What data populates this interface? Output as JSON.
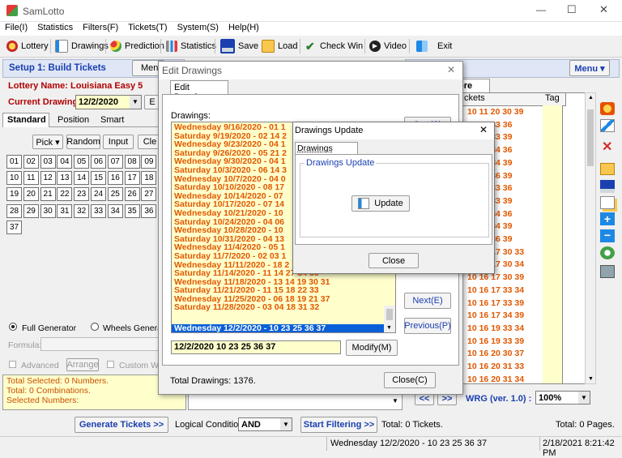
{
  "app": {
    "title": "SamLotto",
    "minimize": "—",
    "maximize": "☐",
    "close": "✕"
  },
  "menu": [
    "File(I)",
    "Statistics",
    "Filters(F)",
    "Tickets(T)",
    "System(S)",
    "Help(H)"
  ],
  "toolbar": {
    "lottery": "Lottery",
    "drawings": "Drawings",
    "prediction": "Prediction",
    "statistics": "Statistics",
    "save": "Save",
    "load": "Load",
    "check_win": "Check Win",
    "video": "Video",
    "exit": "Exit"
  },
  "left": {
    "setup": "Setup 1: Build  Tickets",
    "menu_btn": "Menu",
    "lottery_name": "Lottery  Name: Louisiana Easy 5",
    "current_drawing_label": "Current Drawing:",
    "current_drawing_value": "12/2/2020",
    "b_btn": "E",
    "tabs": [
      "Standard",
      "Position",
      "Smart"
    ],
    "pick": "Pick ▾",
    "random": "Random",
    "input": "Input",
    "clear": "Cle",
    "numbers": [
      "01",
      "02",
      "03",
      "04",
      "05",
      "06",
      "07",
      "08",
      "09",
      "10",
      "11",
      "12",
      "13",
      "14",
      "15",
      "16",
      "17",
      "18",
      "19",
      "20",
      "21",
      "22",
      "23",
      "24",
      "25",
      "26",
      "27",
      "28",
      "29",
      "30",
      "31",
      "32",
      "33",
      "34",
      "35",
      "36",
      "37"
    ],
    "full_generator": "Full Generator",
    "wheels_generator": "Wheels Generat",
    "formula": "Formula:",
    "advanced": "Advanced",
    "arrange": "Arrange",
    "custom": "Custom Wh",
    "status": [
      "Total Selected: 0 Numbers.",
      "Total: 0 Combinations.",
      "Selected Numbers:"
    ]
  },
  "right": {
    "menu_btn": "Menu ▾",
    "tab_fragment": "ore",
    "col_tickets": "ckets",
    "col_tag": "Tag",
    "tickets": [
      "10 11 20 30 39",
      "10 20 33 36",
      "10 20 33 39",
      "10 20 34 36",
      "10 20 34 39",
      "10 20 36 39",
      "10 30 33 36",
      "10 30 33 39",
      "10 30 34 36",
      "10 30 34 39",
      "10 30 36 39",
      "10 16 17 30 33",
      "10 16 17 30 34",
      "10 16 17 30 39",
      "10 16 17 33 34",
      "10 16 17 33 39",
      "10 16 17 34 39",
      "10 16 19 33 34",
      "10 16 19 33 39",
      "10 16 20 30 37",
      "10 16 20 31 33",
      "10 16 20 31 34"
    ],
    "wrg": "WRG (ver. 1.0) :",
    "zoom": "100%"
  },
  "bottom": {
    "generate": "Generate Tickets >>",
    "logical": "Logical Condition:",
    "logical_value": "AND",
    "filtering": "Start Filtering >>",
    "total_tickets": "Total: 0 Tickets.",
    "total_pages": "Total: 0 Pages.",
    "status_drawing": "Wednesday 12/2/2020 - 10 23 25 36 37",
    "status_time": "2/18/2021 8:21:42 PM"
  },
  "edit_drawings": {
    "title": "Edit Drawings",
    "tab": "Edit Drawings",
    "label": "Drawings:",
    "items": [
      "Wednesday 9/16/2020 - 01 1",
      "Saturday 9/19/2020 - 02 14 2",
      "Wednesday 9/23/2020 - 04 1",
      "Saturday 9/26/2020 - 05 21 2",
      "Wednesday 9/30/2020 - 04 1",
      "Saturday 10/3/2020 - 06 14 3",
      "Wednesday 10/7/2020 - 04 0",
      "Saturday 10/10/2020 - 08 17",
      "Wednesday 10/14/2020 - 07",
      "Saturday 10/17/2020 - 07 14",
      "Wednesday 10/21/2020 - 10",
      "Saturday 10/24/2020 - 04 06",
      "Wednesday 10/28/2020 - 10",
      "Saturday 10/31/2020 - 04 13",
      "Wednesday 11/4/2020 - 05 1",
      "Saturday 11/7/2020 - 02 03 1",
      "Wednesday 11/11/2020 - 18 2",
      "Saturday 11/14/2020 - 11 14 27 34 36",
      "Wednesday 11/18/2020 - 13 14 19 30 31",
      "Saturday 11/21/2020 - 11 15 18 22 33",
      "Wednesday 11/25/2020 - 06 18 19 21 37",
      "Saturday 11/28/2020 - 03 04 18 31 32"
    ],
    "selected_item": "Wednesday 12/2/2020 - 10 23 25 36 37",
    "edit_value": "12/2/2020 10 23 25 36 37",
    "modify": "Modify(M)",
    "next": "Next(E)",
    "previous": "Previous(P)",
    "top_btn": "Sort(S)",
    "total": "Total Drawings: 1376.",
    "close": "Close(C)"
  },
  "drawings_update": {
    "title": "Drawings Update",
    "tab": "Drawings Update",
    "group": "Drawings Update",
    "update": "Update",
    "close": "Close"
  },
  "colors": {
    "accent_blue": "#1a3fb0",
    "list_orange": "#e25700",
    "ticket_bg": "#ffffcc",
    "select_blue": "#0a60d8"
  }
}
